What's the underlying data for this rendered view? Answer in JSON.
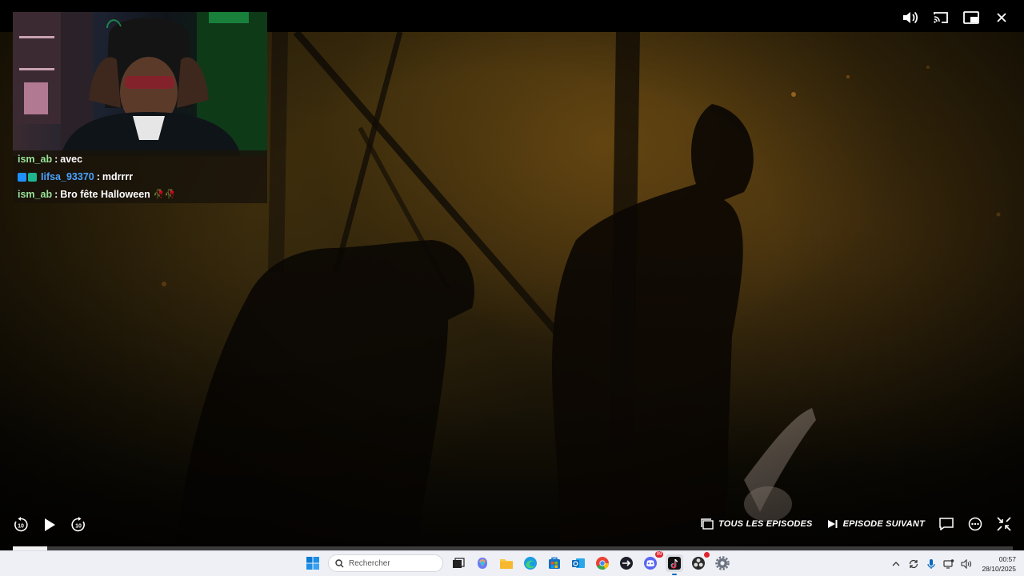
{
  "player": {
    "top_controls": [
      "volume-icon",
      "cast-icon",
      "picture-in-picture-icon",
      "close-icon"
    ],
    "buttons": {
      "all_episodes": "TOUS LES EPISODES",
      "next_episode": "EPISODE SUIVANT"
    },
    "progress": 0.034
  },
  "stream_overlay": {
    "chat": [
      {
        "user": "ism_ab",
        "separator": ":",
        "message": "avec",
        "user_color": "#9be39b",
        "badges": [],
        "emoji": ""
      },
      {
        "user": "Iifsa_93370",
        "separator": ":",
        "message": "mdrrrr",
        "user_color": "#4aa3ff",
        "badges": [
          "#1e90ff",
          "#1fb58f"
        ],
        "emoji": ""
      },
      {
        "user": "ism_ab",
        "separator": ":",
        "message": "Bro fête Halloween",
        "user_color": "#9be39b",
        "badges": [],
        "emoji": "🥀🥀"
      }
    ]
  },
  "taskbar": {
    "search_placeholder": "Rechercher",
    "apps": [
      "windows-start-icon",
      "task-view-icon",
      "copilot-icon",
      "file-explorer-icon",
      "edge-icon",
      "store-icon",
      "outlook-icon",
      "chrome-icon",
      "arrow-app-icon",
      "discord-icon",
      "tiktok-icon",
      "obs-icon",
      "settings-icon"
    ],
    "discord_badge": "99",
    "time": "00:57",
    "date": "28/10/2025"
  },
  "colors": {
    "accent": "#0067c0",
    "taskbar_bg": "#eef0f5",
    "chat_bg": "#19120a"
  }
}
